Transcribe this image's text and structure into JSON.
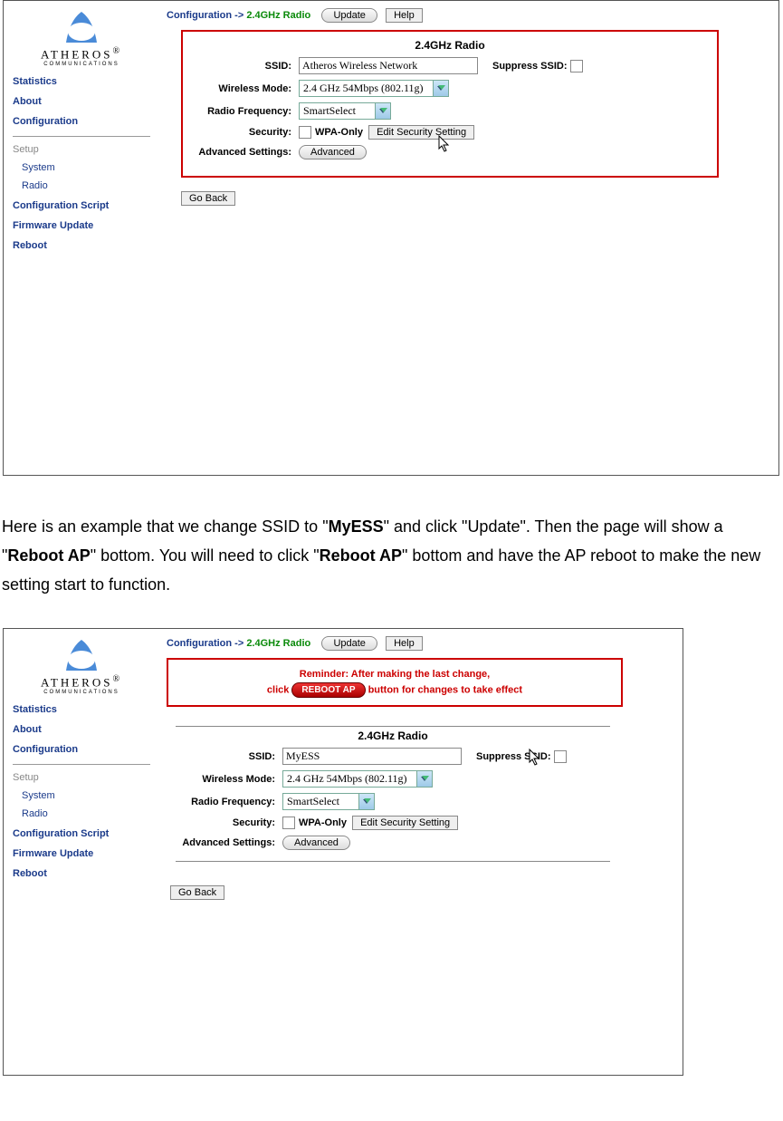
{
  "logo": {
    "name": "ATHEROS",
    "reg": "®",
    "sub": "COMMUNICATIONS"
  },
  "nav": {
    "statistics": "Statistics",
    "about": "About",
    "configuration": "Configuration",
    "setup": "Setup",
    "system": "System",
    "radio": "Radio",
    "script": "Configuration Script",
    "firmware": "Firmware Update",
    "reboot": "Reboot"
  },
  "crumb": {
    "label": "Configuration ->",
    "current": "2.4GHz Radio"
  },
  "buttons": {
    "update": "Update",
    "help": "Help",
    "goback": "Go Back",
    "edit_sec": "Edit Security Setting",
    "advanced": "Advanced",
    "reboot_ap": "REBOOT AP"
  },
  "panel": {
    "title": "2.4GHz Radio",
    "ssid_label": "SSID:",
    "suppress_label": "Suppress SSID:",
    "mode_label": "Wireless Mode:",
    "freq_label": "Radio Frequency:",
    "sec_label": "Security:",
    "adv_label": "Advanced Settings:",
    "wpa_only": "WPA-Only",
    "ssid_value_1": "Atheros Wireless Network",
    "ssid_value_2": "MyESS",
    "mode_value": "2.4 GHz 54Mbps (802.11g)",
    "freq_value": "SmartSelect"
  },
  "reminder": {
    "line1": "Reminder: After making the last change,",
    "line2a": "click",
    "line2b": "button for changes to take effect"
  },
  "prose": {
    "p1a": "Here is an example that we change SSID to \"",
    "p1b": "MyESS",
    "p1c": "\" and click \"Update\". Then the page will show a \"",
    "p1d": "Reboot AP",
    "p1e": "\" bottom. You will need to click \"",
    "p1f": "Reboot AP",
    "p1g": "\" bottom and have the AP reboot to make the new setting start to function."
  }
}
